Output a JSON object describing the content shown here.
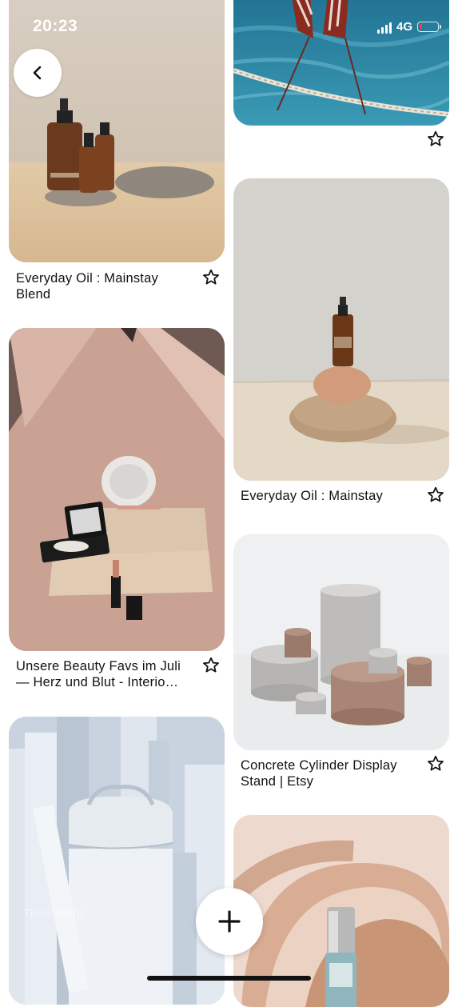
{
  "status_bar": {
    "time": "20:23",
    "network": "4G",
    "battery_color": "#ff3b30"
  },
  "icons": {
    "back": "chevron-left-icon",
    "save": "star-outline-icon",
    "add": "plus-icon"
  },
  "pins": [
    {
      "title": "Everyday Oil : Mainstay Blend"
    },
    {
      "title": ""
    },
    {
      "title": "Unsere Beauty Favs im Juli — Herz und Blut - Interio…"
    },
    {
      "title": "Everyday Oil : Mainstay"
    },
    {
      "title": ""
    },
    {
      "title": "Concrete Cylinder  Display Stand | Etsy"
    },
    {
      "title": ""
    }
  ]
}
